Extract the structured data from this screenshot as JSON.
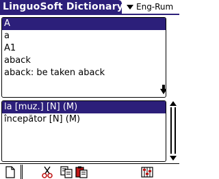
{
  "app": {
    "title": "LinguoSoft Dictionary",
    "language_pair": "Eng-Rum"
  },
  "word_list": {
    "items": [
      "A",
      "a",
      "A1",
      "aback",
      "aback: be taken aback"
    ],
    "selected_index": 0
  },
  "translations": {
    "items": [
      "la [muz.] [N] (M)",
      "începător [N] (M)"
    ],
    "selected_index": 0
  },
  "toolbar": {
    "icons": [
      "new-document-icon",
      "cut-icon",
      "copy-icon",
      "paste-icon",
      "settings-icon"
    ]
  },
  "colors": {
    "accent": "#2c1f7a",
    "icon_red": "#c01818",
    "background": "#ffffff"
  }
}
